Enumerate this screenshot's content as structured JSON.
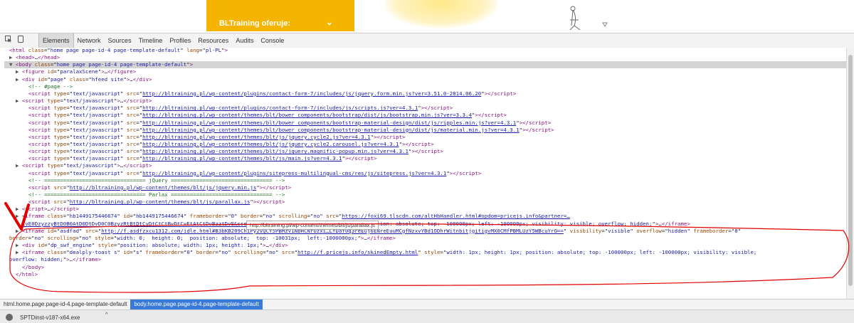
{
  "site": {
    "dropdown_label": "BLTraining oferuje:",
    "chevron_icon": "chevron-down-icon"
  },
  "toolbar": {
    "inspect_icon": "inspect-icon",
    "device_icon": "device-icon",
    "tabs": [
      "Elements",
      "Network",
      "Sources",
      "Timeline",
      "Profiles",
      "Resources",
      "Audits",
      "Console"
    ],
    "active_tab": "Elements"
  },
  "dom": [
    {
      "t": "open",
      "indent": 0,
      "tri": "",
      "html": "<span class=\"tg\">&lt;html</span> <span class=\"at\">class</span>=\"<span class=\"av\">home page page-id-4 page-template-default</span>\" <span class=\"at\">lang</span>=\"<span class=\"av\">pl-PL</span>\"<span class=\"tg\">&gt;</span>"
    },
    {
      "indent": 1,
      "tri": "▶",
      "html": "<span class=\"tg\">&lt;head&gt;</span>…<span class=\"tg\">&lt;/head&gt;</span>"
    },
    {
      "indent": 1,
      "tri": "▼",
      "sel": true,
      "html": "<span class=\"tg\">&lt;body</span> <span class=\"at\">class</span>=\"<span class=\"av\">home page page-id-4 page-template-default</span>\"<span class=\"tg\">&gt;</span>"
    },
    {
      "indent": 2,
      "tri": "▶",
      "html": "<span class=\"tg\">&lt;figure</span> <span class=\"at\">id</span>=\"<span class=\"av\">paralaxScene</span>\"<span class=\"tg\">&gt;</span>…<span class=\"tg\">&lt;/figure&gt;</span>"
    },
    {
      "indent": 2,
      "tri": "▶",
      "html": "<span class=\"tg\">&lt;div</span> <span class=\"at\">id</span>=\"<span class=\"av\">page</span>\" <span class=\"at\">class</span>=\"<span class=\"av\">hfeed site</span>\"<span class=\"tg\">&gt;</span>…<span class=\"tg\">&lt;/div&gt;</span>"
    },
    {
      "indent": 3,
      "tri": "",
      "html": "<span class=\"cm\">&lt;!-- #page --&gt;</span>"
    },
    {
      "indent": 3,
      "tri": "",
      "html": "<span class=\"tg\">&lt;script</span> <span class=\"at\">type</span>=\"<span class=\"av\">text/javascript</span>\" <span class=\"at\">src</span>=\"<span class=\"lk\">http://bltraining.pl/wp-content/plugins/contact-form-7/includes/js/jquery.form.min.js?ver=3.51.0-2014.06.20</span>\"<span class=\"tg\">&gt;&lt;/script&gt;</span>"
    },
    {
      "indent": 2,
      "tri": "▶",
      "html": "<span class=\"tg\">&lt;script</span> <span class=\"at\">type</span>=\"<span class=\"av\">text/javascript</span>\"<span class=\"tg\">&gt;</span>…<span class=\"tg\">&lt;/script&gt;</span>"
    },
    {
      "indent": 3,
      "tri": "",
      "html": "<span class=\"tg\">&lt;script</span> <span class=\"at\">type</span>=\"<span class=\"av\">text/javascript</span>\" <span class=\"at\">src</span>=\"<span class=\"lk\">http://bltraining.pl/wp-content/plugins/contact-form-7/includes/js/scripts.js?ver=4.3.1</span>\"<span class=\"tg\">&gt;&lt;/script&gt;</span>"
    },
    {
      "indent": 3,
      "tri": "",
      "html": "<span class=\"tg\">&lt;script</span> <span class=\"at\">type</span>=\"<span class=\"av\">text/javascript</span>\" <span class=\"at\">src</span>=\"<span class=\"lk\">http://bltraining.pl/wp-content/themes/blt/bower_components/bootstrap/dist/js/bootstrap.min.js?ver=3.3.4</span>\"<span class=\"tg\">&gt;&lt;/script&gt;</span>"
    },
    {
      "indent": 3,
      "tri": "",
      "html": "<span class=\"tg\">&lt;script</span> <span class=\"at\">type</span>=\"<span class=\"av\">text/javascript</span>\" <span class=\"at\">src</span>=\"<span class=\"lk\">http://bltraining.pl/wp-content/themes/blt/bower_components/bootstrap-material-design/dist/js/ripples.min.js?ver=4.3.1</span>\"<span class=\"tg\">&gt;&lt;/script&gt;</span>"
    },
    {
      "indent": 3,
      "tri": "",
      "html": "<span class=\"tg\">&lt;script</span> <span class=\"at\">type</span>=\"<span class=\"av\">text/javascript</span>\" <span class=\"at\">src</span>=\"<span class=\"lk\">http://bltraining.pl/wp-content/themes/blt/bower_components/bootstrap-material-design/dist/js/material.min.js?ver=4.3.1</span>\"<span class=\"tg\">&gt;&lt;/script&gt;</span>"
    },
    {
      "indent": 3,
      "tri": "",
      "html": "<span class=\"tg\">&lt;script</span> <span class=\"at\">type</span>=\"<span class=\"av\">text/javascript</span>\" <span class=\"at\">src</span>=\"<span class=\"lk\">http://bltraining.pl/wp-content/themes/blt/js/jquery.cycle2.js?ver=4.3.1</span>\"<span class=\"tg\">&gt;&lt;/script&gt;</span>"
    },
    {
      "indent": 3,
      "tri": "",
      "html": "<span class=\"tg\">&lt;script</span> <span class=\"at\">type</span>=\"<span class=\"av\">text/javascript</span>\" <span class=\"at\">src</span>=\"<span class=\"lk\">http://bltraining.pl/wp-content/themes/blt/js/jquery.cycle2.carousel.js?ver=4.3.1</span>\"<span class=\"tg\">&gt;&lt;/script&gt;</span>"
    },
    {
      "indent": 3,
      "tri": "",
      "html": "<span class=\"tg\">&lt;script</span> <span class=\"at\">type</span>=\"<span class=\"av\">text/javascript</span>\" <span class=\"at\">src</span>=\"<span class=\"lk\">http://bltraining.pl/wp-content/themes/blt/js/jquery.magnific-popup.min.js?ver=4.3.1</span>\"<span class=\"tg\">&gt;&lt;/script&gt;</span>"
    },
    {
      "indent": 3,
      "tri": "",
      "html": "<span class=\"tg\">&lt;script</span> <span class=\"at\">type</span>=\"<span class=\"av\">text/javascript</span>\" <span class=\"at\">src</span>=\"<span class=\"lk\">http://bltraining.pl/wp-content/themes/blt/js/main.js?ver=4.3.1</span>\"<span class=\"tg\">&gt;&lt;/script&gt;</span>"
    },
    {
      "indent": 2,
      "tri": "▶",
      "html": "<span class=\"tg\">&lt;script</span> <span class=\"at\">type</span>=\"<span class=\"av\">text/javascript</span>\"<span class=\"tg\">&gt;</span>…<span class=\"tg\">&lt;/script&gt;</span>"
    },
    {
      "indent": 3,
      "tri": "",
      "html": "<span class=\"tg\">&lt;script</span> <span class=\"at\">type</span>=\"<span class=\"av\">text/javascript</span>\" <span class=\"at\">src</span>=\"<span class=\"lk\">http://bltraining.pl/wp-content/plugins/sitepress-multilingual-cms/res/js/sitepress.js?ver=4.3.1</span>\"<span class=\"tg\">&gt;&lt;/script&gt;</span>"
    },
    {
      "indent": 3,
      "tri": "",
      "html": "<span class=\"cm\">&lt;!-- ================================ jQuery ================================ --&gt;</span>"
    },
    {
      "indent": 3,
      "tri": "",
      "html": "<span class=\"tg\">&lt;script</span> <span class=\"at\">src</span>=\"<span class=\"lk\">http://bltraining.pl/wp-content/themes/blt/js/jquery.min.js</span>\"<span class=\"tg\">&gt;&lt;/script&gt;</span>"
    },
    {
      "indent": 3,
      "tri": "",
      "html": "<span class=\"cm\">&lt;!-- ================================ Parlax ================================ --&gt;</span>"
    },
    {
      "indent": 3,
      "tri": "",
      "html": "<span class=\"tg\">&lt;script</span> <span class=\"at\">src</span>=\"<span class=\"lk\">http://bltraining.pl/wp-content/themes/blt/js/parallax.js</span>\"<span class=\"tg\">&gt;&lt;/script&gt;</span>"
    },
    {
      "indent": 2,
      "tri": "▶",
      "html": "<span class=\"tg\">&lt;script&gt;</span>…<span class=\"tg\">&lt;/script&gt;</span>"
    },
    {
      "indent": 2,
      "tri": "▶",
      "html": "<span class=\"tg\">&lt;iframe</span> <span class=\"at\">class</span>=\"<span class=\"av\">hb1449175446674</span>\" <span class=\"at\">id</span>=\"<span class=\"av\">hb1449175446674</span>\" <span class=\"at\">frameborder</span>=\"<span class=\"av\">0</span>\" <span class=\"at\">border</span>=\"<span class=\"av\">no</span>\" <span class=\"at\">scrolling</span>=\"<span class=\"av\">no</span>\" <span class=\"at\">src</span>=\"<span class=\"lk\">https://foxi69.tlscdn.com/altHbHandler.html#opdom=pricejs.info&amp;partner=…</span>"
    },
    {
      "indent": 2,
      "tri": "",
      "html": "<span class=\"lk\">CvE0DzyzzyBtD0B0AtD0DtDvD0C0BzyzRtBtDtCvDtCtCtBvDtCvEtAtCtDvBzztDvE&amp;sset=1</span>\" <span class=\"at\">style</span>=\"<span class=\"av\">width: 1px; height: 1px; position: absolute; top: -100000px; left: -100000px; visibility: visible; overflow: hidden;</span>\"<span class=\"tg\">&gt;</span>…<span class=\"tg\">&lt;/iframe&gt;</span>"
    },
    {
      "indent": 2,
      "tri": "▶",
      "html": "<span class=\"tg\">&lt;iframe</span> <span class=\"at\">id</span>=\"<span class=\"av\">asdfad</span>\" <span class=\"at\">src</span>=\"<span class=\"lk\">http://f.asdfzxcu1312.com/idle.html#B3bKB209ChiPy2vQCY5PBMzV1NbHCNrUzxi…LfDaf0q3reEuj6ENreEuuMCgfNzxvYBd1ODhrWitnbitjgitigvMX0CMfPBMLUzY5WBcuYrG==</span>\" <span class=\"at\">visibility</span>=\"<span class=\"av\">visible</span>\" <span class=\"at\">overflow</span>=\"<span class=\"av\">hidden</span>\" <span class=\"at\">frameborder</span>=\"<span class=\"av\">0</span>\""
    },
    {
      "indent": 0,
      "tri": "",
      "html": "<span class=\"at\">border</span>=\"<span class=\"av\">no</span>\" <span class=\"at\">scrolling</span>=\"<span class=\"av\">no</span>\" <span class=\"at\">style</span>=\"<span class=\"av\">width: 0;  height: 0;  position: absolute;  top: -10031px;  left:-1000000px;</span>\"<span class=\"tg\">&gt;</span>…<span class=\"tg\">&lt;/iframe&gt;</span>"
    },
    {
      "indent": 2,
      "tri": "▶",
      "html": "<span class=\"tg\">&lt;div</span> <span class=\"at\">id</span>=\"<span class=\"av\">dp_swf_engine</span>\" <span class=\"at\">style</span>=\"<span class=\"av\">position: absolute; width: 1px; height: 1px;</span>\"<span class=\"tg\">&gt;</span>…<span class=\"tg\">&lt;/div&gt;</span>"
    },
    {
      "indent": 2,
      "tri": "▶",
      "html": "<span class=\"tg\">&lt;iframe</span> <span class=\"at\">class</span>=\"<span class=\"av\">dealply-toast s</span>\" <span class=\"at\">id</span>=\"<span class=\"av\">s</span>\" <span class=\"at\">frameborder</span>=\"<span class=\"av\">0</span>\" <span class=\"at\">border</span>=\"<span class=\"av\">no</span>\" <span class=\"at\">scrolling</span>=\"<span class=\"av\">no</span>\" <span class=\"at\">src</span>=\"<span class=\"lk\">http://f.pricejs.info/skinedEmpty.html</span>\" <span class=\"at\">style</span>=\"<span class=\"av\">width: 1px; height: 1px; position: absolute; top: -100000px; left: -100000px; visibility: visible;</span>"
    },
    {
      "indent": 0,
      "tri": "",
      "html": "<span class=\"av\">overflow: hidden;</span>\"<span class=\"tg\">&gt;</span>…<span class=\"tg\">&lt;/iframe&gt;</span>"
    },
    {
      "indent": 2,
      "tri": "",
      "html": "<span class=\"tg\">&lt;/body&gt;</span>"
    },
    {
      "indent": 1,
      "tri": "",
      "html": "<span class=\"tg\">&lt;/html&gt;</span>"
    }
  ],
  "tooltip": "http://bltraining.pl/wp-content/themes/blt/js/parallax.js",
  "breadcrumbs": [
    "html.home.page.page-id-4.page-template-default",
    "body.home.page.page-id-4.page-template-default"
  ],
  "download": {
    "filename": "SPTDinst-v187-x64.exe",
    "caret": "^"
  },
  "colors": {
    "site_accent": "#f5b400",
    "annotation_red": "#e00000",
    "selected_row": "#d4d4d4",
    "breadcrumb_active": "#3879d9"
  }
}
